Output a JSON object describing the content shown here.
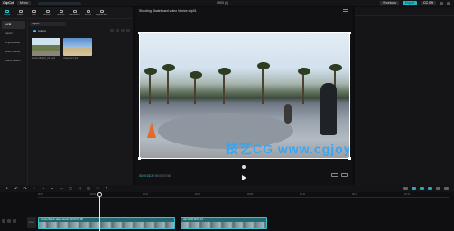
{
  "titlebar": {
    "logo": "CapCut",
    "menu_label": "Menu",
    "project_name": "0903 (4)",
    "shortcuts_label": "Shortcuts",
    "export_label": "Export",
    "badge": "CC 0.9"
  },
  "media_panel": {
    "tabs": [
      {
        "label": "Media",
        "icon": "media-icon"
      },
      {
        "label": "Audio",
        "icon": "audio-icon"
      },
      {
        "label": "Text",
        "icon": "text-icon"
      },
      {
        "label": "Stickers",
        "icon": "sticker-icon"
      },
      {
        "label": "Effects",
        "icon": "effects-icon"
      },
      {
        "label": "Transitions",
        "icon": "transition-icon"
      },
      {
        "label": "Filters",
        "icon": "filter-icon"
      },
      {
        "label": "Adjustment",
        "icon": "adjust-icon"
      }
    ],
    "subnav": [
      "Local",
      "Import",
      "AI generated",
      "Stock videos",
      "Brand assets"
    ],
    "import_label": "Import",
    "filter_label": "Added",
    "thumbnails": [
      {
        "caption": "Venice Beach_01.mp4"
      },
      {
        "caption": "video_02.mp4"
      }
    ]
  },
  "player": {
    "title": "Shooting Skateboard video Venice clip01",
    "current_time": "00:00:02:20",
    "duration": "00:00:07:08",
    "watermark": "技艺CG www.cgjoy.cn"
  },
  "timeline": {
    "ticks": [
      "00:00",
      "00:02",
      "00:04",
      "00:06",
      "00:08",
      "00:10",
      "00:12",
      "00:14"
    ],
    "cover_label": "Cover",
    "clips": [
      {
        "title": "Venice Beach skate session 00:00:07:08"
      },
      {
        "title": "clip 02 00:00:04:12"
      }
    ]
  }
}
